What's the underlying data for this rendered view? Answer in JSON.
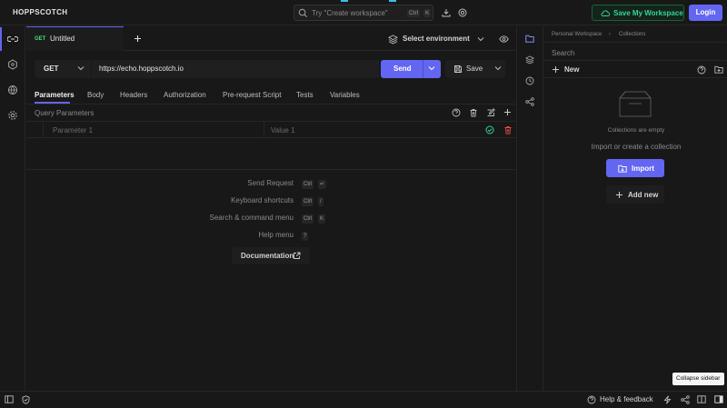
{
  "app": {
    "brand": "HOPPSCOTCH"
  },
  "search": {
    "placeholder": "Try \"Create workspace\"",
    "key1": "Ctrl",
    "key2": "K"
  },
  "header": {
    "save_workspace": "Save My Workspace",
    "login": "Login"
  },
  "tab": {
    "method": "GET",
    "title": "Untitled"
  },
  "environment": {
    "label": "Select environment"
  },
  "request": {
    "method": "GET",
    "url": "https://echo.hoppscotch.io",
    "send": "Send",
    "save": "Save"
  },
  "request_tabs": [
    "Parameters",
    "Body",
    "Headers",
    "Authorization",
    "Pre-request Script",
    "Tests",
    "Variables"
  ],
  "query": {
    "title": "Query Parameters",
    "param_placeholder": "Parameter 1",
    "value_placeholder": "Value 1"
  },
  "shortcuts": [
    {
      "label": "Send Request",
      "k1": "Ctrl",
      "k2": "↵"
    },
    {
      "label": "Keyboard shortcuts",
      "k1": "Ctrl",
      "k2": "/"
    },
    {
      "label": "Search & command menu",
      "k1": "Ctrl",
      "k2": "K"
    },
    {
      "label": "Help menu",
      "k1": "",
      "k2": "?"
    }
  ],
  "documentation": "Documentation",
  "collections": {
    "breadcrumb_root": "Personal Workspace",
    "breadcrumb_sep": "›",
    "breadcrumb_current": "Collections",
    "search_placeholder": "Search",
    "new_label": "New",
    "empty": "Collections are empty",
    "hint": "Import or create a collection",
    "import": "Import",
    "add_new": "Add new"
  },
  "footer": {
    "help": "Help & feedback",
    "tooltip": "Collapse sidebar"
  },
  "colors": {
    "accent": "#6366f1",
    "success": "#34d399",
    "danger": "#ef4444",
    "method_get": "#4ade80"
  }
}
